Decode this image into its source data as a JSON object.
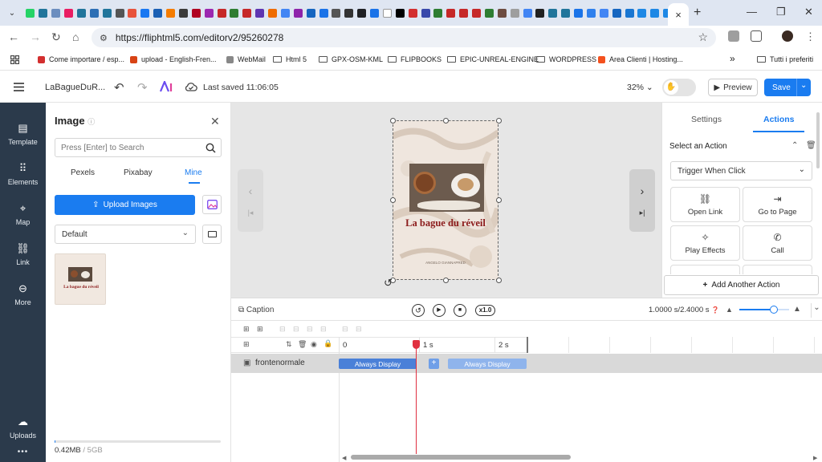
{
  "browser": {
    "tab_favicon_colors": [
      "#25d366",
      "#21759b",
      "#6c8ebf",
      "#e91e63",
      "#21759b",
      "#2d6fb5",
      "#21759b",
      "#555555",
      "#e8533b",
      "#1877f2",
      "#1a5fb4",
      "#f57c00",
      "#3b3b3b",
      "#b00020",
      "#9c27b0",
      "#c62828",
      "#2e7d32",
      "#c62828",
      "#5e35b1",
      "#ef6c00",
      "#4285f4",
      "#8e24aa",
      "#1565c0",
      "#1a73e8",
      "#555555",
      "#333333",
      "#202124",
      "#1a73e8",
      "#ffffff",
      "#000000",
      "#d32f2f",
      "#3949ab",
      "#2e7d32",
      "#c62828",
      "#c62828",
      "#c62828",
      "#2e7d32",
      "#6d4c41",
      "#9e9e9e",
      "#4285f4",
      "#212121",
      "#21759b",
      "#21759b",
      "#1a73e8",
      "#2f80ed",
      "#4285f4",
      "#1565c0",
      "#1976d2",
      "#1e88e5",
      "#1e88e5",
      "#1e88e5"
    ],
    "active_tab_close": "×",
    "new_tab": "+",
    "url": "https://fliphtml5.com/editorv2/95260278",
    "bookmarks": [
      {
        "label": "Come importare / esp...",
        "icon": "k-icon"
      },
      {
        "label": "upload - English-Fren...",
        "icon": "wr-icon"
      },
      {
        "label": "WebMail",
        "icon": "webmail-icon"
      },
      {
        "label": "Html 5",
        "icon": "folder-icon"
      },
      {
        "label": "GPX-OSM-KML",
        "icon": "folder-icon"
      },
      {
        "label": "FLIPBOOKS",
        "icon": "folder-icon"
      },
      {
        "label": "EPIC-UNREAL-ENGINE",
        "icon": "folder-icon"
      },
      {
        "label": "WORDPRESS",
        "icon": "folder-icon"
      },
      {
        "label": "Area Clienti | Hosting...",
        "icon": "star-icon"
      }
    ],
    "bookmarks_more": "»",
    "all_bookmarks": "Tutti i preferiti"
  },
  "header": {
    "title": "LaBagueDuR...",
    "last_saved": "Last saved 11:06:05",
    "zoom": "32%",
    "preview": "Preview",
    "save": "Save"
  },
  "leftnav": {
    "items": [
      {
        "label": "Template",
        "icon": "template-icon"
      },
      {
        "label": "Elements",
        "icon": "elements-icon"
      },
      {
        "label": "Map",
        "icon": "map-pin-icon"
      },
      {
        "label": "Link",
        "icon": "link-icon"
      },
      {
        "label": "More",
        "icon": "more-icon"
      }
    ],
    "uploads": "Uploads",
    "dots": "•••"
  },
  "image_panel": {
    "title": "Image",
    "search_placeholder": "Press [Enter] to Search",
    "tabs": [
      "Pexels",
      "Pixabay",
      "Mine"
    ],
    "active_tab": "Mine",
    "upload_label": "Upload Images",
    "folder_select": "Default",
    "thumb_title": "La bague du réveil",
    "storage_used": "0.42MB",
    "storage_sep": "/",
    "storage_total": "5GB"
  },
  "canvas": {
    "cover_title": "La bague du réveil",
    "cover_author": "ANGELO GIANNAPRED",
    "prev_arrow": "‹",
    "next_arrow": "›"
  },
  "right_panel": {
    "tabs": [
      "Settings",
      "Actions"
    ],
    "active_tab": "Actions",
    "section_title": "Select an Action",
    "trigger": "Trigger When Click",
    "actions": [
      {
        "label": "Open Link",
        "icon": "link-icon"
      },
      {
        "label": "Go to Page",
        "icon": "goto-page-icon"
      },
      {
        "label": "Play Effects",
        "icon": "sparkle-icon"
      },
      {
        "label": "Call",
        "icon": "phone-icon"
      }
    ],
    "add_action": "Add Another Action"
  },
  "timeline": {
    "caption": "Caption",
    "speed": "x1.0",
    "duration": "1.0000 s/2.4000 s",
    "zoom_level": 0.7,
    "ticks": [
      "0",
      "1 s",
      "2 s"
    ],
    "layer_name": "frontenormale",
    "display_pills": [
      "Always Display",
      "Always Display"
    ],
    "plus": "+"
  },
  "colors": {
    "accent": "#1a7cf0",
    "nav_bg": "#2b3a4b",
    "playhead": "#e03040",
    "pill": "#6f9fe8",
    "pill_active": "#4a80d8"
  }
}
